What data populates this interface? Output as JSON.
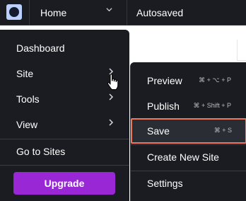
{
  "topbar": {
    "logo_icon": "site-logo-icon",
    "page_selector": {
      "label": "Home",
      "icon": "chevron-down-icon"
    },
    "status": "Autosaved"
  },
  "main_menu": {
    "items": [
      {
        "label": "Dashboard",
        "has_submenu": false
      },
      {
        "label": "Site",
        "has_submenu": true,
        "hovered": true
      },
      {
        "label": "Tools",
        "has_submenu": true
      },
      {
        "label": "View",
        "has_submenu": true
      },
      {
        "label": "Go to Sites",
        "has_submenu": false
      }
    ],
    "upgrade_label": "Upgrade",
    "upgrade_color": "#9a27d5"
  },
  "site_submenu": {
    "items": [
      {
        "label": "Preview",
        "shortcut": "⌘ + ⌥ + P"
      },
      {
        "label": "Publish",
        "shortcut": "⌘ + Shift + P"
      },
      {
        "label": "Save",
        "shortcut": "⌘ + S",
        "highlighted": true
      },
      {
        "label": "Create New Site",
        "shortcut": ""
      },
      {
        "label": "Settings",
        "shortcut": ""
      }
    ],
    "highlight_color": "#ee7b60"
  },
  "colors": {
    "menu_bg": "#1b1c22",
    "text": "#ffffff"
  }
}
